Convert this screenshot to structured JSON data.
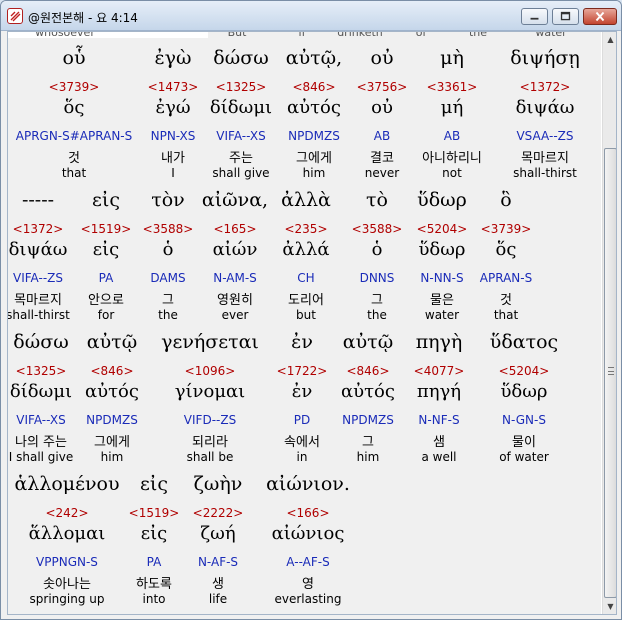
{
  "window": {
    "title": "@원전본해 - 요 4:14",
    "minimize_icon": "minimize-icon",
    "maximize_icon": "maximize-icon",
    "close_icon": "close-icon"
  },
  "top_fragment": [
    "whosoever",
    "But",
    "if",
    "drinketh",
    "of",
    "the",
    "water"
  ],
  "rows": [
    {
      "words": [
        {
          "greek": "οὗ",
          "strong": "<3739>",
          "lemma": "ὅς",
          "morph": "APRGN-S#APRAN-S",
          "korean": "것",
          "english": "that"
        },
        {
          "greek": "ἐγὼ",
          "strong": "<1473>",
          "lemma": "ἐγώ",
          "morph": "NPN-XS",
          "korean": "내가",
          "english": "I"
        },
        {
          "greek": "δώσω",
          "strong": "<1325>",
          "lemma": "δίδωμι",
          "morph": "VIFA--XS",
          "korean": "주는",
          "english": "shall give"
        },
        {
          "greek": "αὐτῷ,",
          "strong": "<846>",
          "lemma": "αὐτός",
          "morph": "NPDMZS",
          "korean": "그에게",
          "english": "him"
        },
        {
          "greek": "οὐ",
          "strong": "<3756>",
          "lemma": "οὐ",
          "morph": "AB",
          "korean": "결코",
          "english": "never"
        },
        {
          "greek": "μὴ",
          "strong": "<3361>",
          "lemma": "μή",
          "morph": "AB",
          "korean": "아니하리니",
          "english": "not"
        },
        {
          "greek": "διψήσῃ",
          "strong": "<1372>",
          "lemma": "διψάω",
          "morph": "VSAA--ZS",
          "korean": "목마르지",
          "english": "shall-thirst"
        }
      ]
    },
    {
      "words": [
        {
          "greek": "-----",
          "strong": "<1372>",
          "lemma": "διψάω",
          "morph": "VIFA--ZS",
          "korean": "목마르지",
          "english": "shall-thirst"
        },
        {
          "greek": "εἰς",
          "strong": "<1519>",
          "lemma": "εἰς",
          "morph": "PA",
          "korean": "안으로",
          "english": "for"
        },
        {
          "greek": "τὸν",
          "strong": "<3588>",
          "lemma": "ὁ",
          "morph": "DAMS",
          "korean": "그",
          "english": "the"
        },
        {
          "greek": "αἰῶνα,",
          "strong": "<165>",
          "lemma": "αἰών",
          "morph": "N-AM-S",
          "korean": "영원히",
          "english": "ever"
        },
        {
          "greek": "ἀλλὰ",
          "strong": "<235>",
          "lemma": "ἀλλά",
          "morph": "CH",
          "korean": "도리어",
          "english": "but"
        },
        {
          "greek": "τὸ",
          "strong": "<3588>",
          "lemma": "ὁ",
          "morph": "DNNS",
          "korean": "그",
          "english": "the"
        },
        {
          "greek": "ὕδωρ",
          "strong": "<5204>",
          "lemma": "ὕδωρ",
          "morph": "N-NN-S",
          "korean": "물은",
          "english": "water"
        },
        {
          "greek": "ὃ",
          "strong": "<3739>",
          "lemma": "ὅς",
          "morph": "APRAN-S",
          "korean": "것",
          "english": "that"
        }
      ]
    },
    {
      "words": [
        {
          "greek": "δώσω",
          "strong": "<1325>",
          "lemma": "δίδωμι",
          "morph": "VIFA--XS",
          "korean": "나의 주는",
          "english": "I shall give"
        },
        {
          "greek": "αὐτῷ",
          "strong": "<846>",
          "lemma": "αὐτός",
          "morph": "NPDMZS",
          "korean": "그에게",
          "english": "him"
        },
        {
          "greek": "γενήσεται",
          "strong": "<1096>",
          "lemma": "γίνομαι",
          "morph": "VIFD--ZS",
          "korean": "되리라",
          "english": "shall be"
        },
        {
          "greek": "ἐν",
          "strong": "<1722>",
          "lemma": "ἐν",
          "morph": "PD",
          "korean": "속에서",
          "english": "in"
        },
        {
          "greek": "αὐτῷ",
          "strong": "<846>",
          "lemma": "αὐτός",
          "morph": "NPDMZS",
          "korean": "그",
          "english": "him"
        },
        {
          "greek": "πηγὴ",
          "strong": "<4077>",
          "lemma": "πηγή",
          "morph": "N-NF-S",
          "korean": "샘",
          "english": "a well"
        },
        {
          "greek": "ὕδατος",
          "strong": "<5204>",
          "lemma": "ὕδωρ",
          "morph": "N-GN-S",
          "korean": "물이",
          "english": "of water"
        }
      ]
    },
    {
      "words": [
        {
          "greek": "ἁλλομένου",
          "strong": "<242>",
          "lemma": "ἅλλομαι",
          "morph": "VPPNGN-S",
          "korean": "솟아나는",
          "english": "springing up"
        },
        {
          "greek": "εἰς",
          "strong": "<1519>",
          "lemma": "εἰς",
          "morph": "PA",
          "korean": "하도록",
          "english": "into"
        },
        {
          "greek": "ζωὴν",
          "strong": "<2222>",
          "lemma": "ζωή",
          "morph": "N-AF-S",
          "korean": "생",
          "english": "life"
        },
        {
          "greek": "αἰώνιον.",
          "strong": "<166>",
          "lemma": "αἰώνιος",
          "morph": "A--AF-S",
          "korean": "영",
          "english": "everlasting"
        }
      ]
    }
  ]
}
